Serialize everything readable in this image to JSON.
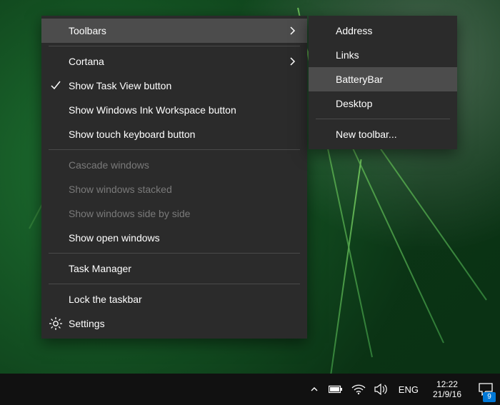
{
  "wallpaper": {
    "description": "green fern leaves"
  },
  "mainMenu": {
    "toolbars": {
      "label": "Toolbars"
    },
    "cortana": {
      "label": "Cortana"
    },
    "taskView": {
      "label": "Show Task View button"
    },
    "inkWorkspace": {
      "label": "Show Windows Ink Workspace button"
    },
    "touchKeyboard": {
      "label": "Show touch keyboard button"
    },
    "cascade": {
      "label": "Cascade windows"
    },
    "stacked": {
      "label": "Show windows stacked"
    },
    "sideBySide": {
      "label": "Show windows side by side"
    },
    "openWindows": {
      "label": "Show open windows"
    },
    "taskManager": {
      "label": "Task Manager"
    },
    "lockTaskbar": {
      "label": "Lock the taskbar"
    },
    "settings": {
      "label": "Settings"
    }
  },
  "subMenu": {
    "address": {
      "label": "Address"
    },
    "links": {
      "label": "Links"
    },
    "batteryBar": {
      "label": "BatteryBar"
    },
    "desktop": {
      "label": "Desktop"
    },
    "newToolbar": {
      "label": "New toolbar..."
    }
  },
  "taskbar": {
    "language": "ENG",
    "time": "12:22",
    "date": "21/9/16",
    "notificationCount": "9"
  }
}
